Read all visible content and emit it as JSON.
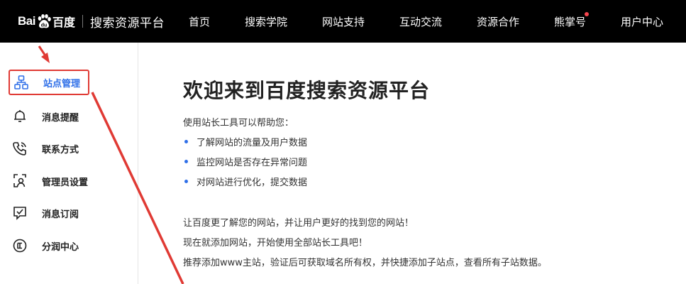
{
  "brand": {
    "logo_text_1": "Bai",
    "logo_text_2": "百度",
    "platform_title": "搜索资源平台"
  },
  "nav": {
    "items": [
      {
        "label": "首页"
      },
      {
        "label": "搜索学院"
      },
      {
        "label": "网站支持"
      },
      {
        "label": "互动交流"
      },
      {
        "label": "资源合作"
      },
      {
        "label": "熊掌号"
      },
      {
        "label": "用户中心"
      }
    ]
  },
  "sidebar": {
    "items": [
      {
        "label": "站点管理",
        "icon": "sitemap-icon",
        "active": true
      },
      {
        "label": "消息提醒",
        "icon": "bell-icon"
      },
      {
        "label": "联系方式",
        "icon": "phone-icon"
      },
      {
        "label": "管理员设置",
        "icon": "admin-icon"
      },
      {
        "label": "消息订阅",
        "icon": "subscribe-icon"
      },
      {
        "label": "分润中心",
        "icon": "revenue-icon"
      }
    ]
  },
  "main": {
    "title": "欢迎来到百度搜索资源平台",
    "intro": "使用站长工具可以帮助您：",
    "bullets": [
      "了解网站的流量及用户数据",
      "监控网站是否存在异常问题",
      "对网站进行优化，提交数据"
    ],
    "para1": "让百度更了解您的网站，并让用户更好的找到您的网站！",
    "para2": "现在就添加网站，开始使用全部站长工具吧！",
    "para3": "推荐添加www主站，验证后可获取域名所有权，并快捷添加子站点，查看所有子站数据。"
  },
  "colors": {
    "topbar": "#000000",
    "accent": "#2f6fe8",
    "annotation": "#e03a34",
    "notification_dot": "#f5454d"
  }
}
